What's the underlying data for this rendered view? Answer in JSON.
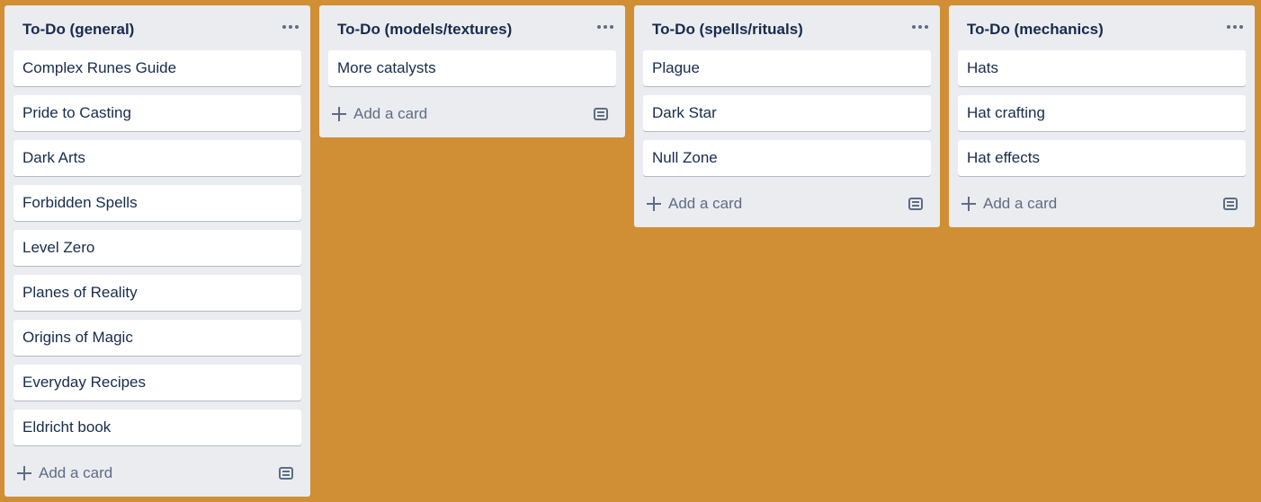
{
  "colors": {
    "board_background": "#d08f34",
    "list_background": "#ebecf0",
    "card_background": "#ffffff",
    "title_text": "#172b4d",
    "muted_text": "#5e6c84"
  },
  "lists": [
    {
      "title": "To-Do (general)",
      "cards": [
        "Complex Runes Guide",
        "Pride to Casting",
        "Dark Arts",
        "Forbidden Spells",
        "Level Zero",
        "Planes of Reality",
        "Origins of Magic",
        "Everyday Recipes",
        "Eldricht book"
      ],
      "add_card_label": "Add a card"
    },
    {
      "title": "To-Do (models/textures)",
      "cards": [
        "More catalysts"
      ],
      "add_card_label": "Add a card"
    },
    {
      "title": "To-Do (spells/rituals)",
      "cards": [
        "Plague",
        "Dark Star",
        "Null Zone"
      ],
      "add_card_label": "Add a card"
    },
    {
      "title": "To-Do (mechanics)",
      "cards": [
        "Hats",
        "Hat crafting",
        "Hat effects"
      ],
      "add_card_label": "Add a card"
    }
  ],
  "icons": {
    "list_menu": "more-horizontal-icon",
    "add": "plus-icon",
    "template": "card-template-icon"
  }
}
